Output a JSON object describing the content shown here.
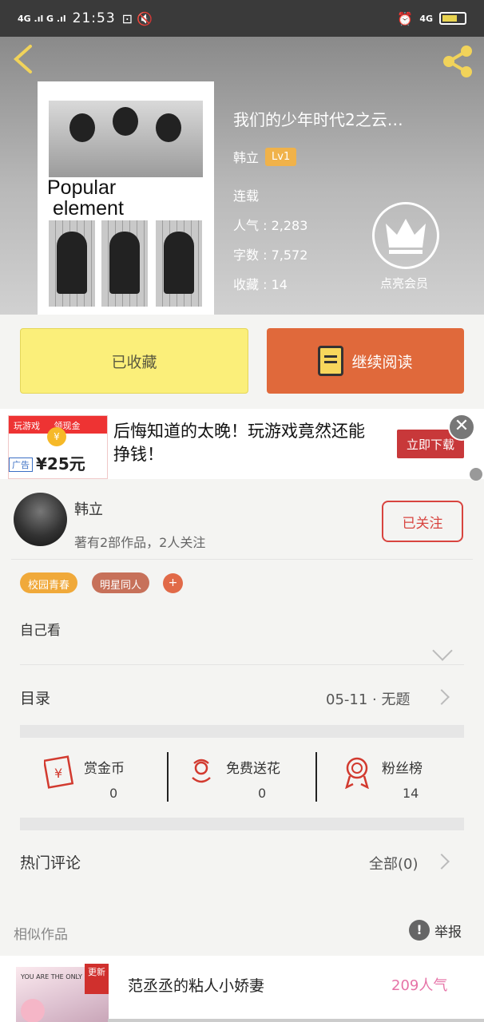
{
  "status_bar": {
    "signal_left": "4G .ıl G .ıl",
    "time": "21:53",
    "network": "4G"
  },
  "book": {
    "title": "我们的少年时代2之云…",
    "author": "韩立",
    "level": "Lv1",
    "status": "连载",
    "popularity_label": "人气",
    "popularity": "2,283",
    "words_label": "字数",
    "words": "7,572",
    "collect_label": "收藏",
    "collects": "14",
    "crown_label": "点亮会员",
    "cover_text": "Popular\nelement"
  },
  "actions": {
    "collected": "已收藏",
    "continue_read": "继续阅读"
  },
  "ad": {
    "headline": "后悔知道的太晚！玩游戏竟然还能挣钱！",
    "button": "立即下载",
    "tag": "广告",
    "brand": "玩游戏",
    "reward": "领现金",
    "amount": "¥25元",
    "close": "✕"
  },
  "author": {
    "name": "韩立",
    "meta": "著有2部作品，2人关注",
    "follow": "已关注"
  },
  "tags": [
    {
      "label": "校园青春",
      "color": "#f0a93a"
    },
    {
      "label": "明星同人",
      "color": "#c7715a"
    }
  ],
  "tag_add": "+",
  "intro": "自己看",
  "catalog": {
    "label": "目录",
    "latest": "05-11 · 无题"
  },
  "stats": [
    {
      "label": "赏金币",
      "value": "0"
    },
    {
      "label": "免费送花",
      "value": "0"
    },
    {
      "label": "粉丝榜",
      "value": "14"
    }
  ],
  "comments": {
    "label": "热门评论",
    "all": "全部(0)"
  },
  "similar": {
    "label": "相似作品",
    "report": "举报"
  },
  "recommend": {
    "badge": "更新",
    "title": "范丞丞的粘人小娇妻",
    "popularity": "209人气",
    "cover_text": "YOU ARE THE ONLY"
  }
}
